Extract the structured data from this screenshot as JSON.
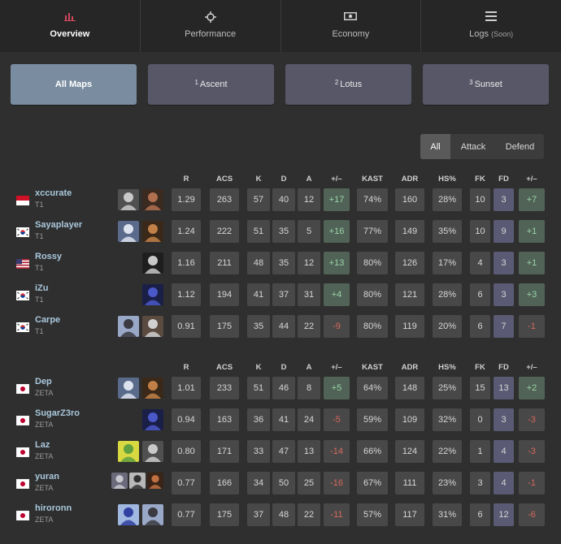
{
  "tabs": [
    {
      "label": "Overview",
      "icon": "bar-chart-icon",
      "active": true
    },
    {
      "label": "Performance",
      "icon": "crosshair-icon",
      "active": false
    },
    {
      "label": "Economy",
      "icon": "money-icon",
      "active": false
    },
    {
      "label": "Logs",
      "note": "(Soon)",
      "icon": "list-icon",
      "active": false
    }
  ],
  "maps": [
    {
      "num": "",
      "label": "All Maps",
      "active": true
    },
    {
      "num": "1",
      "label": "Ascent",
      "active": false
    },
    {
      "num": "2",
      "label": "Lotus",
      "active": false
    },
    {
      "num": "3",
      "label": "Sunset",
      "active": false
    }
  ],
  "side_filter": {
    "all": "All",
    "attack": "Attack",
    "defend": "Defend",
    "active": "All"
  },
  "columns": [
    "R",
    "ACS",
    "K",
    "D",
    "A",
    "+/–",
    "KAST",
    "ADR",
    "HS%",
    "FK",
    "FD",
    "+/–"
  ],
  "teams": [
    {
      "players": [
        {
          "name": "xccurate",
          "team": "T1",
          "flag": "id",
          "agents": [
            "agent-a",
            "agent-b"
          ],
          "stats": [
            "1.29",
            "263",
            "57",
            "40",
            "12",
            "+17",
            "74%",
            "160",
            "28%",
            "10",
            "3",
            "+7"
          ]
        },
        {
          "name": "Sayaplayer",
          "team": "T1",
          "flag": "kr",
          "agents": [
            "agent-c",
            "agent-d"
          ],
          "stats": [
            "1.24",
            "222",
            "51",
            "35",
            "5",
            "+16",
            "77%",
            "149",
            "35%",
            "10",
            "9",
            "+1"
          ]
        },
        {
          "name": "Rossy",
          "team": "T1",
          "flag": "us",
          "agents": [
            "agent-e"
          ],
          "stats": [
            "1.16",
            "211",
            "48",
            "35",
            "12",
            "+13",
            "80%",
            "126",
            "17%",
            "4",
            "3",
            "+1"
          ]
        },
        {
          "name": "iZu",
          "team": "T1",
          "flag": "kr",
          "agents": [
            "agent-f"
          ],
          "stats": [
            "1.12",
            "194",
            "41",
            "37",
            "31",
            "+4",
            "80%",
            "121",
            "28%",
            "6",
            "3",
            "+3"
          ]
        },
        {
          "name": "Carpe",
          "team": "T1",
          "flag": "kr",
          "agents": [
            "agent-g",
            "agent-h"
          ],
          "stats": [
            "0.91",
            "175",
            "35",
            "44",
            "22",
            "-9",
            "80%",
            "119",
            "20%",
            "6",
            "7",
            "-1"
          ]
        }
      ]
    },
    {
      "players": [
        {
          "name": "Dep",
          "team": "ZETA",
          "flag": "jp",
          "agents": [
            "agent-c",
            "agent-d"
          ],
          "stats": [
            "1.01",
            "233",
            "51",
            "46",
            "8",
            "+5",
            "64%",
            "148",
            "25%",
            "15",
            "13",
            "+2"
          ]
        },
        {
          "name": "SugarZ3ro",
          "team": "ZETA",
          "flag": "jp",
          "agents": [
            "agent-f"
          ],
          "stats": [
            "0.94",
            "163",
            "36",
            "41",
            "24",
            "-5",
            "59%",
            "109",
            "32%",
            "0",
            "3",
            "-3"
          ]
        },
        {
          "name": "Laz",
          "team": "ZETA",
          "flag": "jp",
          "agents": [
            "agent-i",
            "agent-a"
          ],
          "stats": [
            "0.80",
            "171",
            "33",
            "47",
            "13",
            "-14",
            "66%",
            "124",
            "22%",
            "1",
            "4",
            "-3"
          ]
        },
        {
          "name": "yuran",
          "team": "ZETA",
          "flag": "jp",
          "agents": [
            "agent-j",
            "agent-k",
            "agent-l"
          ],
          "stats": [
            "0.77",
            "166",
            "34",
            "50",
            "25",
            "-16",
            "67%",
            "111",
            "23%",
            "3",
            "4",
            "-1"
          ]
        },
        {
          "name": "hiroronn",
          "team": "ZETA",
          "flag": "jp",
          "agents": [
            "agent-m",
            "agent-g"
          ],
          "stats": [
            "0.77",
            "175",
            "37",
            "48",
            "22",
            "-11",
            "57%",
            "117",
            "31%",
            "6",
            "12",
            "-6"
          ]
        }
      ]
    }
  ],
  "colors": {
    "accent": "#d0475d",
    "positive": "#9bd3a8",
    "negative": "#d8685e",
    "link": "#a9c8dc"
  }
}
